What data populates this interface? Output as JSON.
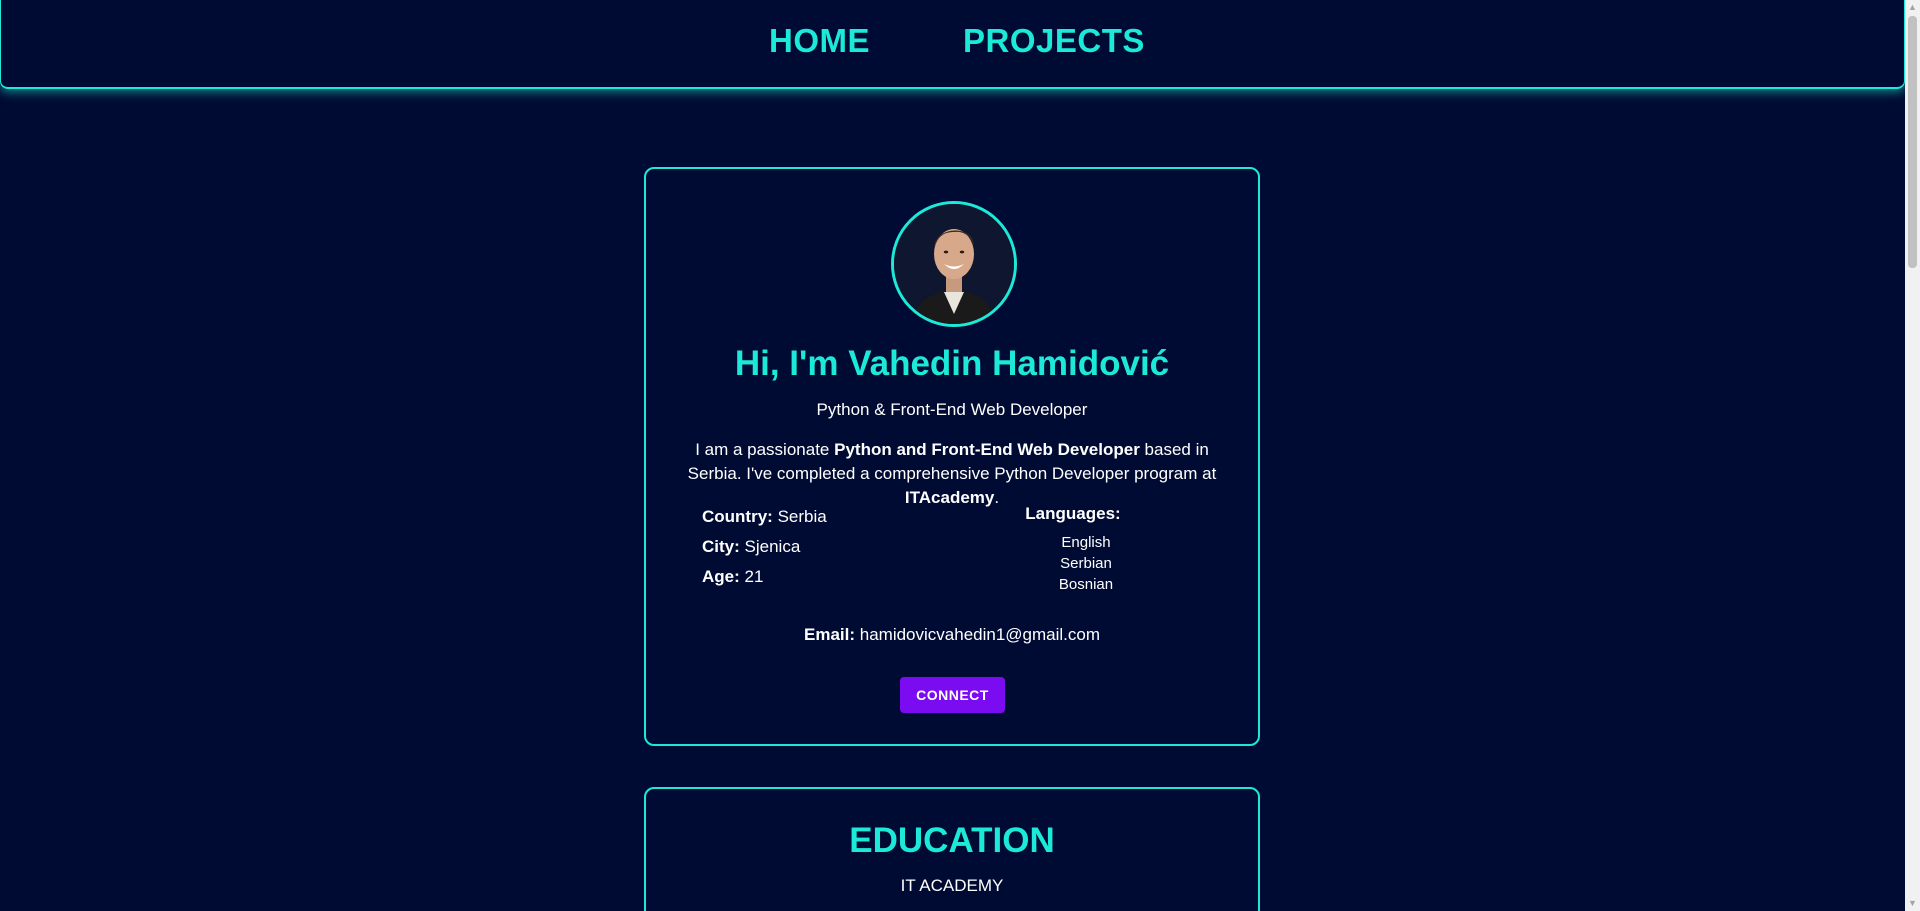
{
  "nav": {
    "home_label": "HOME",
    "projects_label": "PROJECTS"
  },
  "profile": {
    "avatar_icon": "profile-photo",
    "greeting": "Hi, I'm Vahedin Hamidović",
    "role": "Python & Front-End Web Developer",
    "bio": {
      "part1": "I am a passionate ",
      "bold1": "Python and Front-End Web Developer",
      "part2": " based in Serbia. I've completed a comprehensive Python Developer program at ",
      "bold2": "ITAcademy",
      "part3": "."
    },
    "info": {
      "country_label": "Country:",
      "country_value": "Serbia",
      "city_label": "City:",
      "city_value": "Sjenica",
      "age_label": "Age:",
      "age_value": "21"
    },
    "languages": {
      "title": "Languages:",
      "items": [
        "English",
        "Serbian",
        "Bosnian"
      ]
    },
    "email_label": "Email:",
    "email_value": "hamidovicvahedin1@gmail.com",
    "connect_label": "CONNECT"
  },
  "education": {
    "title": "EDUCATION",
    "school": "IT ACADEMY"
  },
  "colors": {
    "background": "#000b33",
    "accent": "#1de9d8",
    "button": "#7b0cf2",
    "text": "#ffffff"
  }
}
